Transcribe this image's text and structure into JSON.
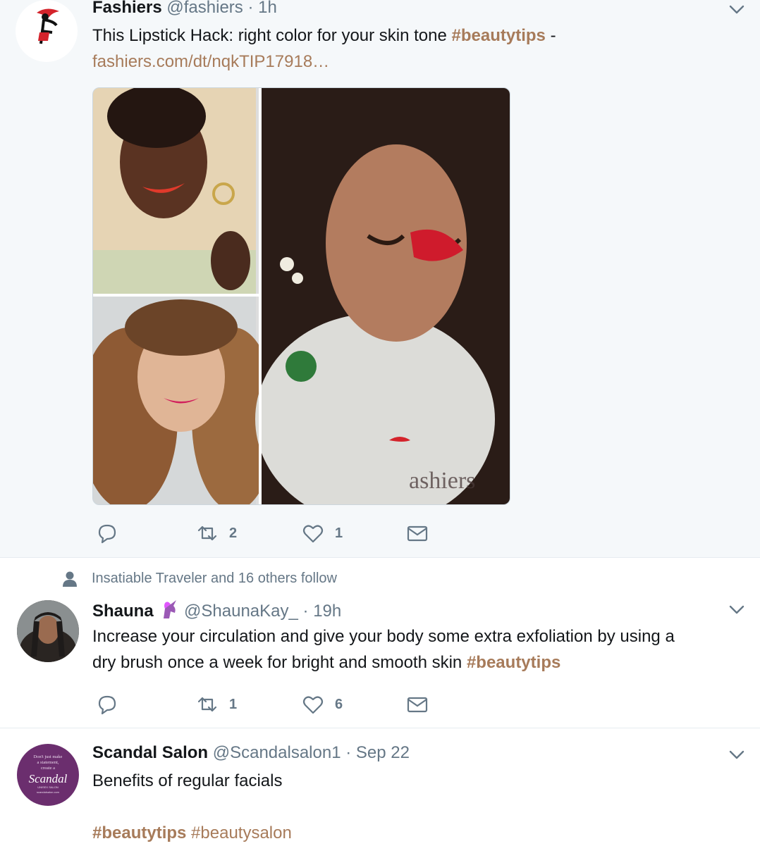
{
  "tweets": [
    {
      "name": "Fashiers",
      "handle": "@fashiers",
      "time": "1h",
      "text": "This Lipstick Hack: right color for your skin tone ",
      "hashtag": "#beautytips",
      "text_suffix": " -",
      "link": "fashiers.com/dt/nqkTIP17918…",
      "watermark": "ashiers",
      "retweets": "2",
      "likes": "1"
    },
    {
      "social_context": "Insatiable Traveler and 16 others follow",
      "name": "Shauna",
      "handle": "@ShaunaKay_",
      "time": "19h",
      "text_line1": "Increase your circulation and give your body some extra exfoliation by using a",
      "text_line2": "dry brush once a week for bright and smooth skin ",
      "hashtag": "#beautytips",
      "retweets": "1",
      "likes": "6"
    },
    {
      "name": "Scandal Salon",
      "handle": "@Scandalsalon1",
      "time": "Sep 22",
      "text": "Benefits of regular facials",
      "hashtag1": "#beautytips",
      "hashtag2": "#beautysalon",
      "avatar_text": [
        "Don't just make",
        "a statement,",
        "create a",
        "Scandal",
        "UNISEX SALON",
        "scandalsalon.com"
      ]
    }
  ],
  "colors": {
    "accent": "#a77b5a",
    "meta": "#657786",
    "divider": "#e6ecf0",
    "highlight_bg": "#f5f8fa"
  }
}
